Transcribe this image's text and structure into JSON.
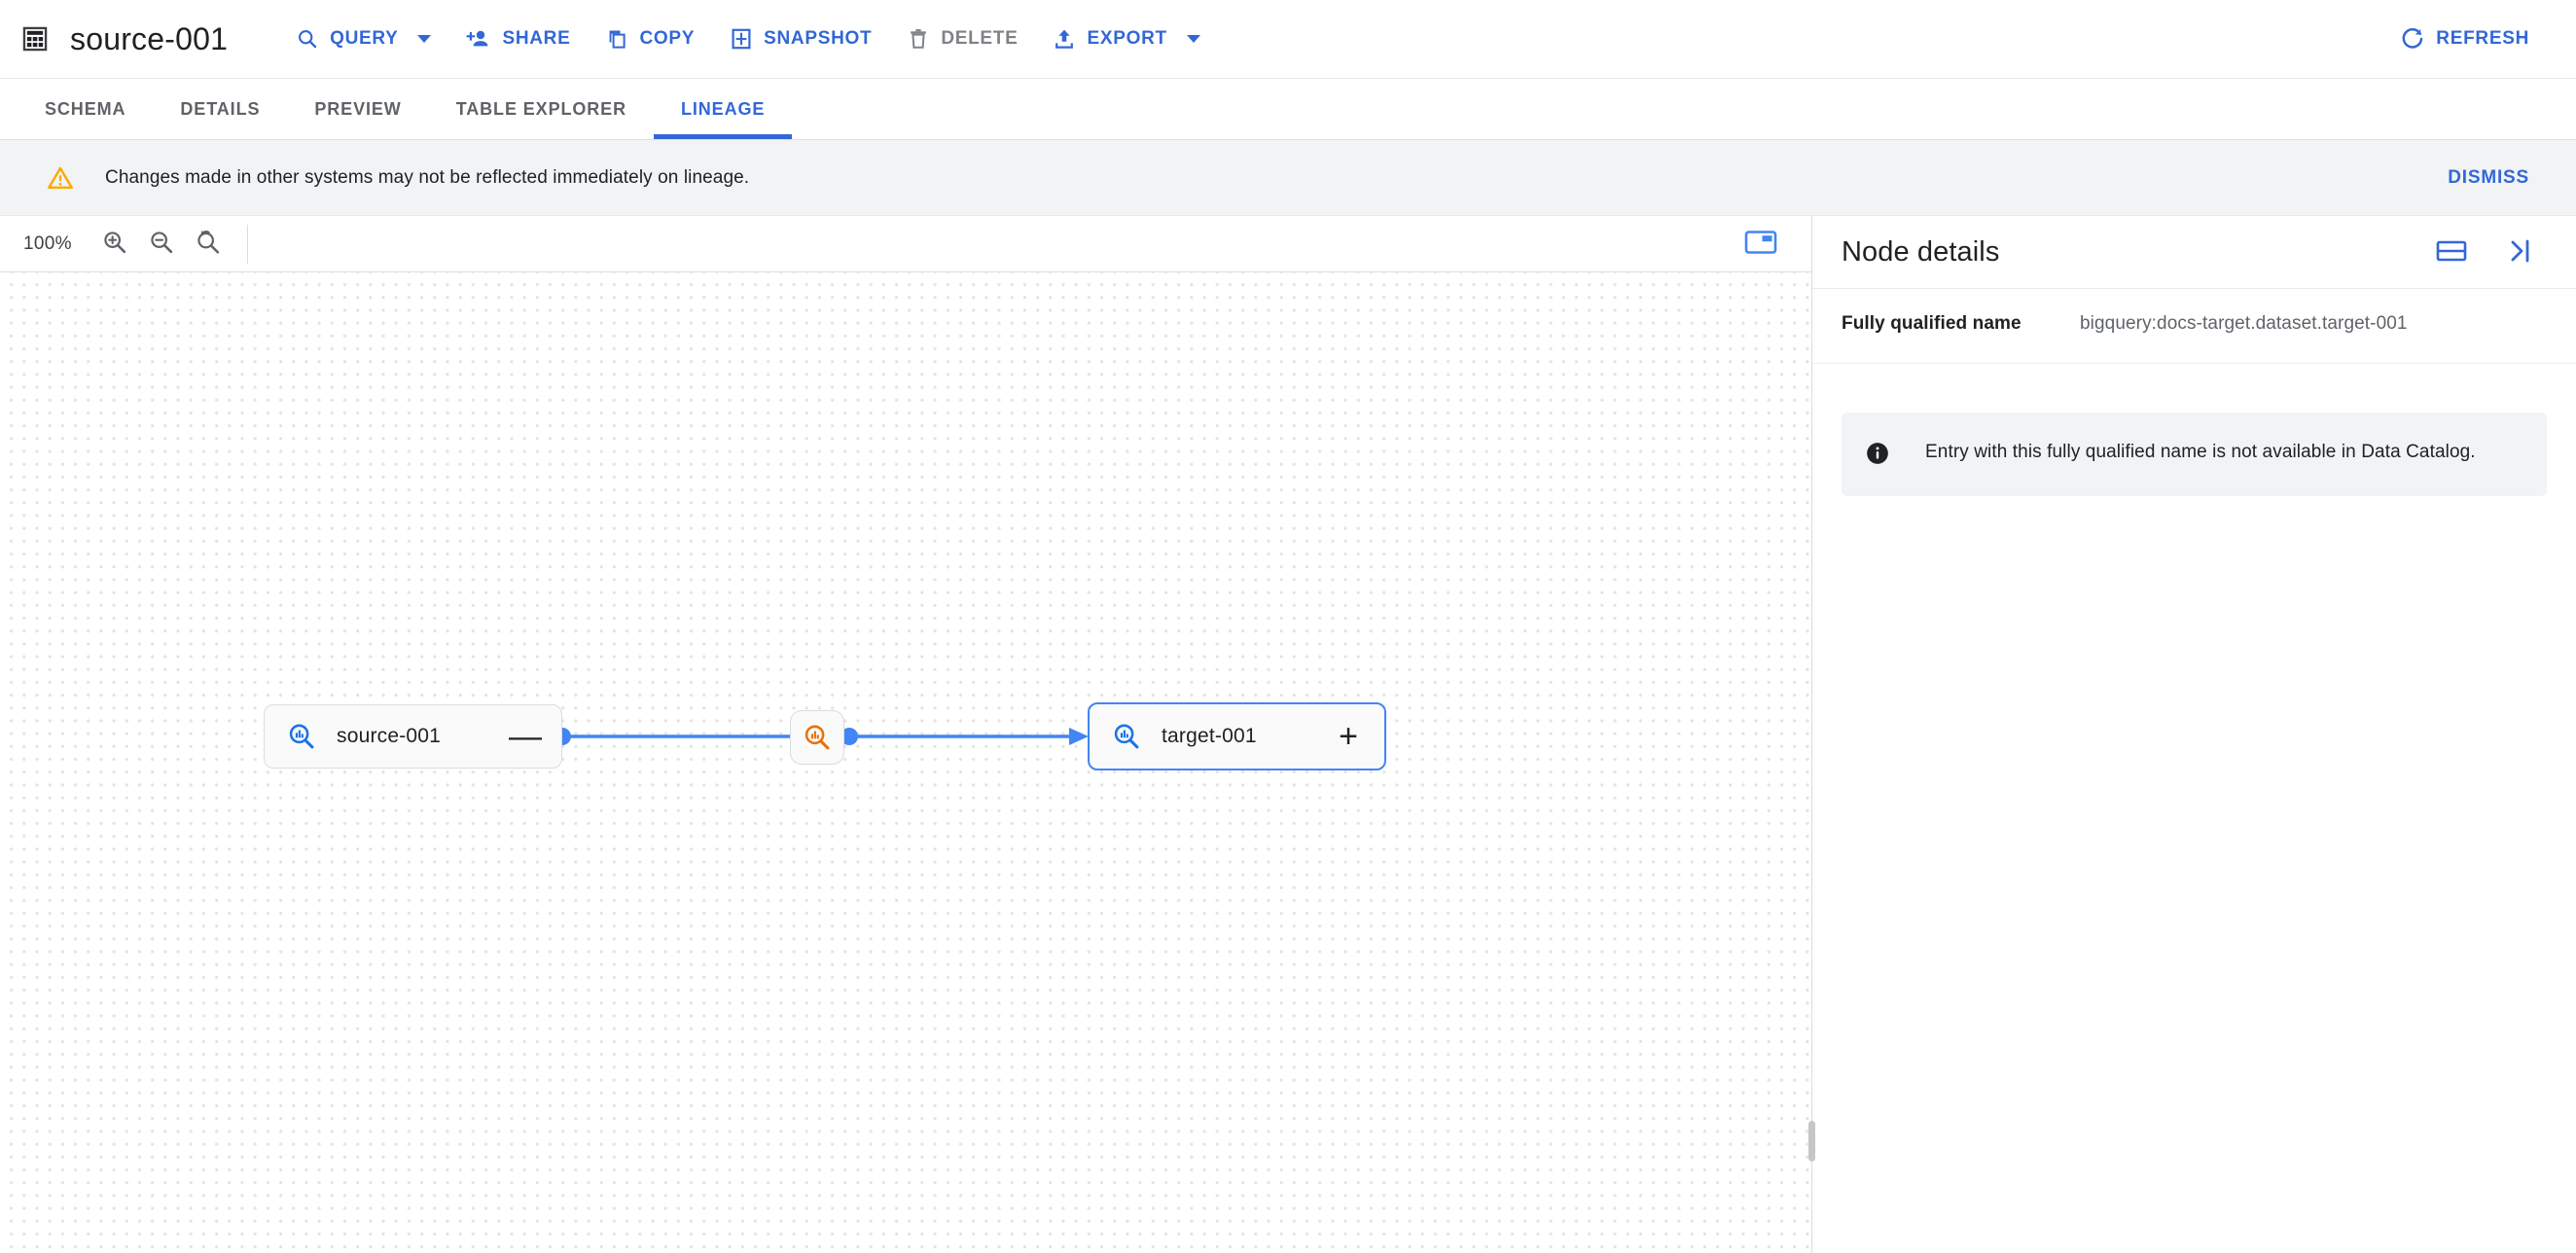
{
  "header": {
    "table_icon": "table-icon",
    "title": "source-001",
    "actions": [
      {
        "label": "QUERY",
        "icon": "search-icon",
        "has_caret": true,
        "disabled": false
      },
      {
        "label": "SHARE",
        "icon": "person-add-icon",
        "has_caret": false,
        "disabled": false
      },
      {
        "label": "COPY",
        "icon": "copy-icon",
        "has_caret": false,
        "disabled": false
      },
      {
        "label": "SNAPSHOT",
        "icon": "snapshot-icon",
        "has_caret": false,
        "disabled": false
      },
      {
        "label": "DELETE",
        "icon": "trash-icon",
        "has_caret": false,
        "disabled": true
      },
      {
        "label": "EXPORT",
        "icon": "export-icon",
        "has_caret": true,
        "disabled": false
      }
    ],
    "refresh": {
      "label": "REFRESH",
      "icon": "refresh-icon"
    }
  },
  "tabs": {
    "items": [
      {
        "label": "SCHEMA",
        "active": false
      },
      {
        "label": "DETAILS",
        "active": false
      },
      {
        "label": "PREVIEW",
        "active": false
      },
      {
        "label": "TABLE EXPLORER",
        "active": false
      },
      {
        "label": "LINEAGE",
        "active": true
      }
    ]
  },
  "banner": {
    "icon": "warning-icon",
    "message": "Changes made in other systems may not be reflected immediately on lineage.",
    "dismiss_label": "DISMISS"
  },
  "canvas_toolbar": {
    "zoom_level": "100%",
    "zoom_in_icon": "zoom-in-icon",
    "zoom_out_icon": "zoom-out-icon",
    "zoom_reset_icon": "zoom-reset-icon",
    "minimap_icon": "minimap-icon"
  },
  "graph": {
    "nodes": [
      {
        "id": "source-001",
        "label": "source-001",
        "icon": "data-catalog-icon",
        "toggle": "—",
        "toggle_action": "collapse",
        "selected": false
      },
      {
        "id": "process",
        "label": "",
        "icon": "process-icon",
        "toggle": "",
        "toggle_action": "",
        "selected": false
      },
      {
        "id": "target-001",
        "label": "target-001",
        "icon": "data-catalog-icon",
        "toggle": "+",
        "toggle_action": "expand",
        "selected": true
      }
    ],
    "edges": [
      {
        "from": "source-001",
        "to": "process"
      },
      {
        "from": "process",
        "to": "target-001"
      }
    ]
  },
  "node_details": {
    "title": "Node details",
    "layout_icon": "split-view-icon",
    "collapse_icon": "collapse-panel-icon",
    "fields": [
      {
        "key": "Fully qualified name",
        "value": "bigquery:docs-target.dataset.target-001"
      }
    ],
    "info": {
      "icon": "info-icon",
      "message": "Entry with this fully qualified name is not available in Data Catalog."
    }
  },
  "colors": {
    "accent": "#3367d6",
    "edge": "#4285f4",
    "process": "#e8710a",
    "warning": "#f9ab00",
    "banner_bg": "#f1f3f4",
    "text": "#202124",
    "muted": "#5f6368"
  }
}
